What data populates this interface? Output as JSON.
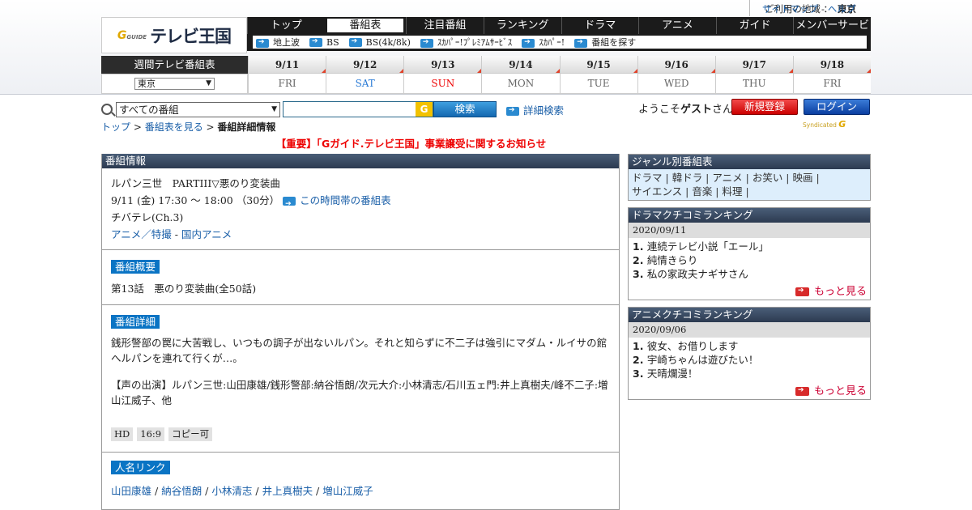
{
  "header": {
    "region_label": "ご利用の地域 ：",
    "region_value": "東京",
    "sitemap": "サイトマップ",
    "sep": "-",
    "help": "ヘルプ",
    "logo_g": "G",
    "logo_g_small": "GUIDE",
    "logo_text": "テレビ王国"
  },
  "main_nav": [
    "トップ",
    "番組表",
    "注目番組",
    "ランキング",
    "ドラマ",
    "アニメ",
    "ガイド",
    "メンバーサービス"
  ],
  "main_nav_active": 1,
  "sub_nav": [
    "地上波",
    "BS",
    "BS(4k/8k)",
    "ｽｶﾊﾟｰ!ﾌﾟﾚﾐｱﾑｻｰﾋﾞｽ",
    "ｽｶﾊﾟｰ!",
    "番組を探す"
  ],
  "week": {
    "title": "週間テレビ番組表",
    "area": "東京",
    "days": [
      {
        "date": "9/11",
        "dow": "FRI",
        "kind": "wd"
      },
      {
        "date": "9/12",
        "dow": "SAT",
        "kind": "sat"
      },
      {
        "date": "9/13",
        "dow": "SUN",
        "kind": "sun"
      },
      {
        "date": "9/14",
        "dow": "MON",
        "kind": "wd"
      },
      {
        "date": "9/15",
        "dow": "TUE",
        "kind": "wd"
      },
      {
        "date": "9/16",
        "dow": "WED",
        "kind": "wd"
      },
      {
        "date": "9/17",
        "dow": "THU",
        "kind": "wd"
      },
      {
        "date": "9/18",
        "dow": "FRI",
        "kind": "wd"
      }
    ]
  },
  "search": {
    "category": "すべての番組",
    "g": "G",
    "button": "検索",
    "advanced": "詳細検索"
  },
  "user": {
    "welcome_pre": "ようこそ",
    "guest": "ゲスト",
    "welcome_post": "さん",
    "register": "新規登録",
    "login": "ログイン",
    "synd_small": "Syndicated",
    "synd_g": "G"
  },
  "breadcrumb": {
    "top": "トップ",
    "sep": " > ",
    "list": "番組表を見る",
    "current": "番組詳細情報"
  },
  "notice": "【重要】「Gガイド.テレビ王国」事業譲受に関するお知らせ",
  "program": {
    "box_title": "番組情報",
    "title": "ルパン三世　PARTIII▽悪のり変装曲",
    "time": "9/11 (金) 17:30 ～ 18:00 （30分）",
    "time_link": "この時間帯の番組表",
    "channel": "チバテレ(Ch.3)",
    "genre_1": "アニメ／特撮",
    "genre_sep": " - ",
    "genre_2": "国内アニメ",
    "summary_tag": "番組概要",
    "summary": "第13話　悪のり変装曲(全50話)",
    "detail_tag": "番組詳細",
    "detail": "銭形警部の罠に大苦戦し、いつもの調子が出ないルパン。それと知らずに不二子は強引にマダム・ルイサの館へルパンを連れて行くが…。",
    "cast": "【声の出演】ルパン三世:山田康雄/銭形警部:納谷悟朗/次元大介:小林清志/石川五ェ門:井上真樹夫/峰不二子:増山江威子、他",
    "badges": [
      "HD",
      "16:9",
      "コピー可"
    ],
    "people_tag": "人名リンク",
    "people": [
      "山田康雄",
      "納谷悟朗",
      "小林清志",
      "井上真樹夫",
      "増山江威子"
    ],
    "people_sep": " / "
  },
  "sidebar": {
    "genre_title": "ジャンル別番組表",
    "genres": [
      "ドラマ",
      "韓ドラ",
      "アニメ",
      "お笑い",
      "映画",
      "サイエンス",
      "音楽",
      "料理"
    ],
    "drama_title": "ドラマクチコミランキング",
    "drama_date": "2020/09/11",
    "drama_items": [
      "連続テレビ小説「エール」",
      "純情きらり",
      "私の家政夫ナギサさん"
    ],
    "anime_title": "アニメクチコミランキング",
    "anime_date": "2020/09/06",
    "anime_items": [
      "彼女、お借りします",
      "宇崎ちゃんは遊びたい！",
      "天晴爛漫！"
    ],
    "more": "もっと見る"
  }
}
